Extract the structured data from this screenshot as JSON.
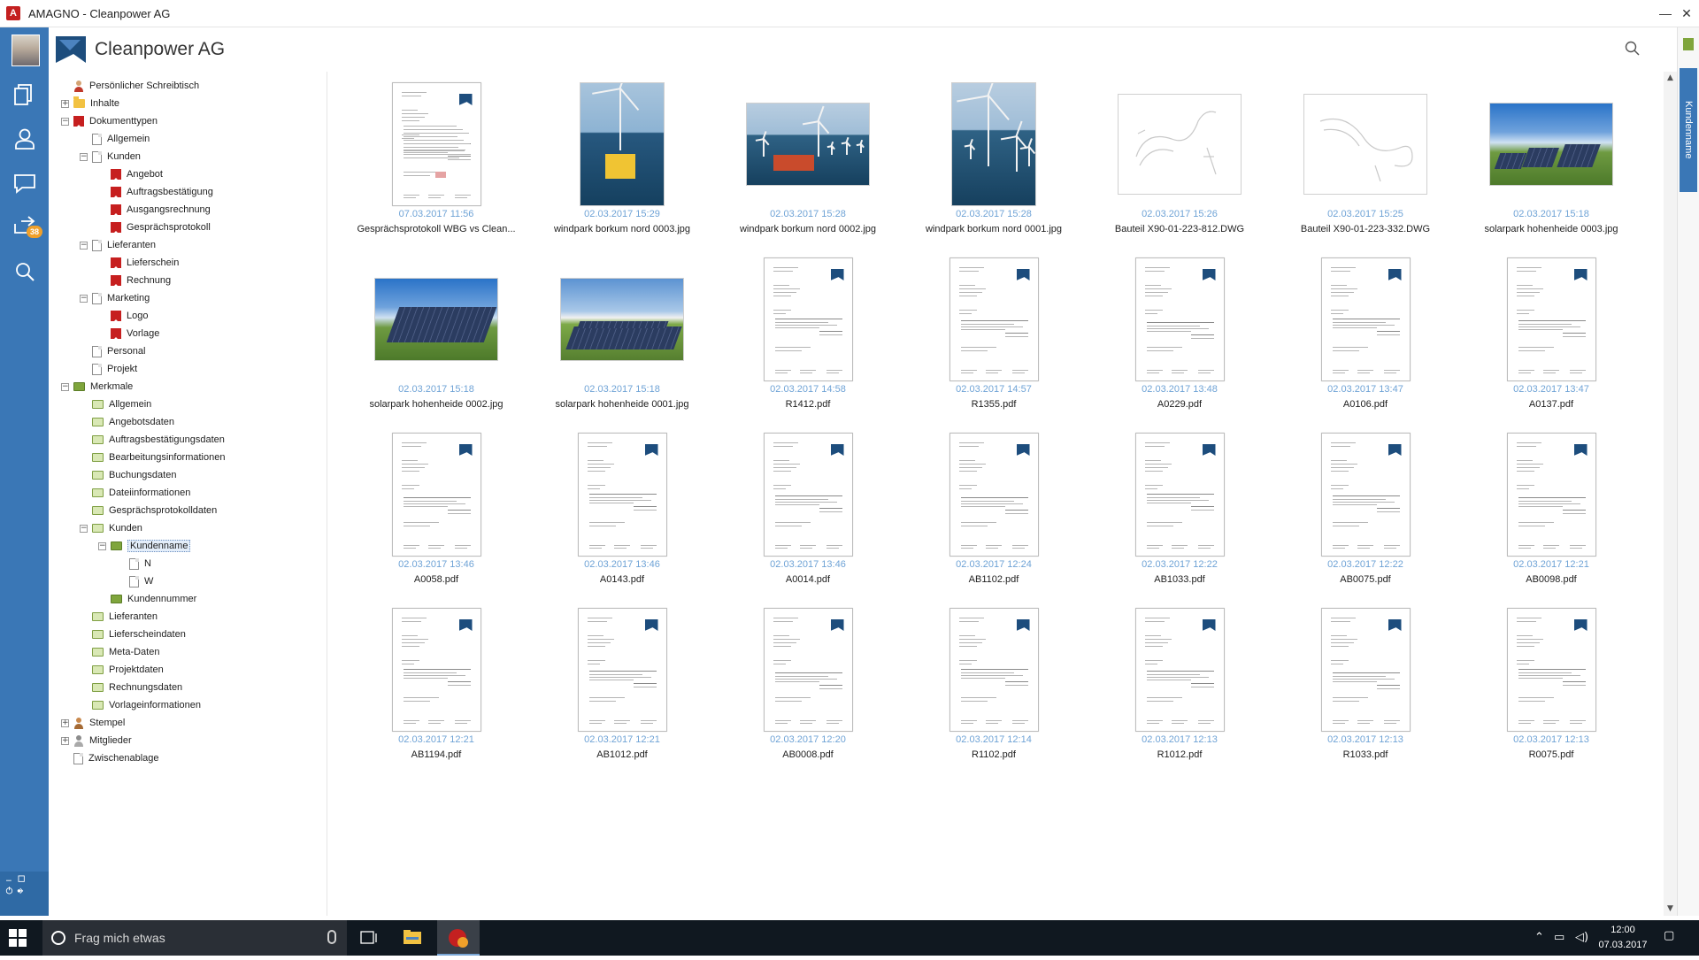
{
  "window": {
    "title": "AMAGNO - Cleanpower AG",
    "controls": [
      "—",
      "▢",
      "✕"
    ]
  },
  "header": {
    "company": "Cleanpower AG"
  },
  "rail": {
    "badge_count": "38",
    "icons": [
      "documents-icon",
      "user-icon",
      "chat-icon",
      "inbox-icon",
      "search-icon"
    ]
  },
  "side_tab": {
    "label": "Kundenname"
  },
  "tree": [
    {
      "label": "Persönlicher Schreibtisch",
      "level": 0,
      "icon": "person",
      "exp": "none"
    },
    {
      "label": "Inhalte",
      "level": 0,
      "icon": "folder",
      "exp": "plus"
    },
    {
      "label": "Dokumenttypen",
      "level": 0,
      "icon": "red",
      "exp": "minus"
    },
    {
      "label": "Allgemein",
      "level": 1,
      "icon": "doc",
      "exp": "none"
    },
    {
      "label": "Kunden",
      "level": 1,
      "icon": "doc",
      "exp": "minus"
    },
    {
      "label": "Angebot",
      "level": 2,
      "icon": "red",
      "exp": "none"
    },
    {
      "label": "Auftragsbestätigung",
      "level": 2,
      "icon": "red",
      "exp": "none"
    },
    {
      "label": "Ausgangsrechnung",
      "level": 2,
      "icon": "red",
      "exp": "none"
    },
    {
      "label": "Gesprächsprotokoll",
      "level": 2,
      "icon": "red",
      "exp": "none"
    },
    {
      "label": "Lieferanten",
      "level": 1,
      "icon": "doc",
      "exp": "minus"
    },
    {
      "label": "Lieferschein",
      "level": 2,
      "icon": "red",
      "exp": "none"
    },
    {
      "label": "Rechnung",
      "level": 2,
      "icon": "red",
      "exp": "none"
    },
    {
      "label": "Marketing",
      "level": 1,
      "icon": "doc",
      "exp": "minus"
    },
    {
      "label": "Logo",
      "level": 2,
      "icon": "red",
      "exp": "none"
    },
    {
      "label": "Vorlage",
      "level": 2,
      "icon": "red",
      "exp": "none"
    },
    {
      "label": "Personal",
      "level": 1,
      "icon": "doc",
      "exp": "none"
    },
    {
      "label": "Projekt",
      "level": 1,
      "icon": "doc",
      "exp": "none"
    },
    {
      "label": "Merkmale",
      "level": 0,
      "icon": "green-dark",
      "exp": "minus"
    },
    {
      "label": "Allgemein",
      "level": 1,
      "icon": "green",
      "exp": "none"
    },
    {
      "label": "Angebotsdaten",
      "level": 1,
      "icon": "green",
      "exp": "none"
    },
    {
      "label": "Auftragsbestätigungsdaten",
      "level": 1,
      "icon": "green",
      "exp": "none"
    },
    {
      "label": "Bearbeitungsinformationen",
      "level": 1,
      "icon": "green",
      "exp": "none"
    },
    {
      "label": "Buchungsdaten",
      "level": 1,
      "icon": "green",
      "exp": "none"
    },
    {
      "label": "Dateiinformationen",
      "level": 1,
      "icon": "green",
      "exp": "none"
    },
    {
      "label": "Gesprächsprotokolldaten",
      "level": 1,
      "icon": "green",
      "exp": "none"
    },
    {
      "label": "Kunden",
      "level": 1,
      "icon": "green",
      "exp": "minus"
    },
    {
      "label": "Kundenname",
      "level": 2,
      "icon": "green-dark",
      "exp": "minus",
      "selected": true
    },
    {
      "label": "N",
      "level": 3,
      "icon": "doc",
      "exp": "none"
    },
    {
      "label": "W",
      "level": 3,
      "icon": "doc",
      "exp": "none"
    },
    {
      "label": "Kundennummer",
      "level": 2,
      "icon": "green-dark",
      "exp": "none"
    },
    {
      "label": "Lieferanten",
      "level": 1,
      "icon": "green",
      "exp": "none"
    },
    {
      "label": "Lieferscheindaten",
      "level": 1,
      "icon": "green",
      "exp": "none"
    },
    {
      "label": "Meta-Daten",
      "level": 1,
      "icon": "green",
      "exp": "none"
    },
    {
      "label": "Projektdaten",
      "level": 1,
      "icon": "green",
      "exp": "none"
    },
    {
      "label": "Rechnungsdaten",
      "level": 1,
      "icon": "green",
      "exp": "none"
    },
    {
      "label": "Vorlageinformationen",
      "level": 1,
      "icon": "green",
      "exp": "none"
    },
    {
      "label": "Stempel",
      "level": 0,
      "icon": "stamp",
      "exp": "plus"
    },
    {
      "label": "Mitglieder",
      "level": 0,
      "icon": "members",
      "exp": "plus"
    },
    {
      "label": "Zwischenablage",
      "level": 0,
      "icon": "doc",
      "exp": "none"
    }
  ],
  "items": [
    {
      "date": "07.03.2017 11:56",
      "name": "Gesprächsprotokoll WBG vs Clean...",
      "kind": "protocol"
    },
    {
      "date": "02.03.2017 15:29",
      "name": "windpark borkum nord 0003.jpg",
      "kind": "wind-portrait"
    },
    {
      "date": "02.03.2017 15:28",
      "name": "windpark borkum nord 0002.jpg",
      "kind": "wind-landscape"
    },
    {
      "date": "02.03.2017 15:28",
      "name": "windpark borkum nord 0001.jpg",
      "kind": "wind-portrait2"
    },
    {
      "date": "02.03.2017 15:26",
      "name": "Bauteil X90-01-223-812.DWG",
      "kind": "cad"
    },
    {
      "date": "02.03.2017 15:25",
      "name": "Bauteil X90-01-223-332.DWG",
      "kind": "cad"
    },
    {
      "date": "02.03.2017 15:18",
      "name": "solarpark hohenheide 0003.jpg",
      "kind": "solar"
    },
    {
      "date": "02.03.2017 15:18",
      "name": "solarpark hohenheide 0002.jpg",
      "kind": "solar-big"
    },
    {
      "date": "02.03.2017 15:18",
      "name": "solarpark hohenheide 0001.jpg",
      "kind": "solar-field"
    },
    {
      "date": "02.03.2017 14:58",
      "name": "R1412.pdf",
      "kind": "pdf"
    },
    {
      "date": "02.03.2017 14:57",
      "name": "R1355.pdf",
      "kind": "pdf"
    },
    {
      "date": "02.03.2017 13:48",
      "name": "A0229.pdf",
      "kind": "pdf"
    },
    {
      "date": "02.03.2017 13:47",
      "name": "A0106.pdf",
      "kind": "pdf"
    },
    {
      "date": "02.03.2017 13:47",
      "name": "A0137.pdf",
      "kind": "pdf"
    },
    {
      "date": "02.03.2017 13:46",
      "name": "A0058.pdf",
      "kind": "pdf"
    },
    {
      "date": "02.03.2017 13:46",
      "name": "A0143.pdf",
      "kind": "pdf"
    },
    {
      "date": "02.03.2017 13:46",
      "name": "A0014.pdf",
      "kind": "pdf"
    },
    {
      "date": "02.03.2017 12:24",
      "name": "AB1102.pdf",
      "kind": "pdf"
    },
    {
      "date": "02.03.2017 12:22",
      "name": "AB1033.pdf",
      "kind": "pdf"
    },
    {
      "date": "02.03.2017 12:22",
      "name": "AB0075.pdf",
      "kind": "pdf"
    },
    {
      "date": "02.03.2017 12:21",
      "name": "AB0098.pdf",
      "kind": "pdf"
    },
    {
      "date": "02.03.2017 12:21",
      "name": "AB1194.pdf",
      "kind": "pdf"
    },
    {
      "date": "02.03.2017 12:21",
      "name": "AB1012.pdf",
      "kind": "pdf"
    },
    {
      "date": "02.03.2017 12:20",
      "name": "AB0008.pdf",
      "kind": "pdf"
    },
    {
      "date": "02.03.2017 12:14",
      "name": "R1102.pdf",
      "kind": "pdf"
    },
    {
      "date": "02.03.2017 12:13",
      "name": "R1012.pdf",
      "kind": "pdf"
    },
    {
      "date": "02.03.2017 12:13",
      "name": "R1033.pdf",
      "kind": "pdf"
    },
    {
      "date": "02.03.2017 12:13",
      "name": "R0075.pdf",
      "kind": "pdf"
    }
  ],
  "taskbar": {
    "search_placeholder": "Frag mich etwas",
    "app_badge": "38",
    "time": "12:00",
    "date": "07.03.2017"
  },
  "colors": {
    "accent": "#3a77b6",
    "date_text": "#6fa3d6",
    "doc_type_red": "#c61f1f",
    "feature_green": "#7fa53c"
  }
}
